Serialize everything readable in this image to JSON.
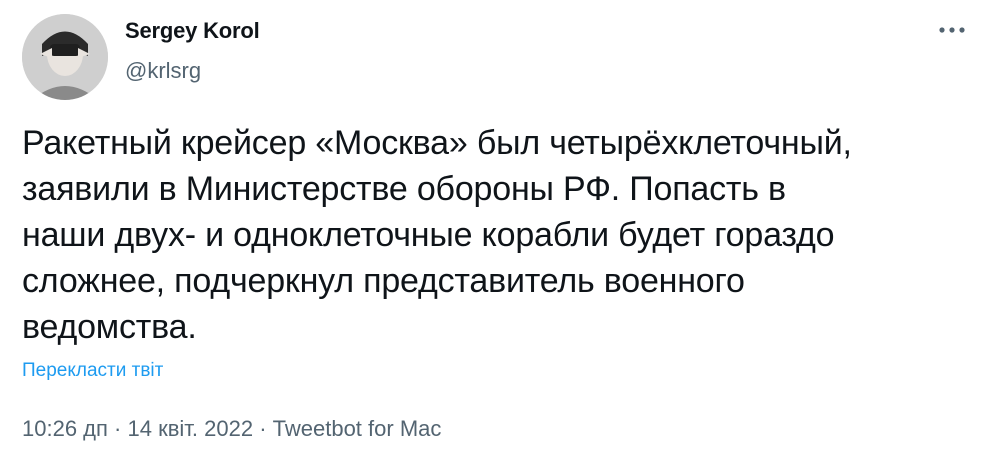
{
  "user": {
    "display_name": "Sergey Korol",
    "handle": "@krlsrg",
    "avatar_icon": "user-avatar"
  },
  "tweet": {
    "text": "Ракетный крейсер «Москва» был четырёхклеточный,\nзаявили в Министерстве обороны РФ. Попасть в\nнаши двух- и одноклеточные корабли будет гораздо\nсложнее, подчеркнул представитель военного\nведомства.",
    "translate_label": "Перекласти твіт",
    "time": "10:26 дп",
    "date": "14 квіт. 2022",
    "source": "Tweetbot for Mac",
    "separator": " · "
  },
  "icons": {
    "more": "more-options-icon"
  },
  "colors": {
    "text": "#0f1419",
    "secondary": "#536471",
    "link": "#1d9bf0",
    "background": "#ffffff"
  }
}
